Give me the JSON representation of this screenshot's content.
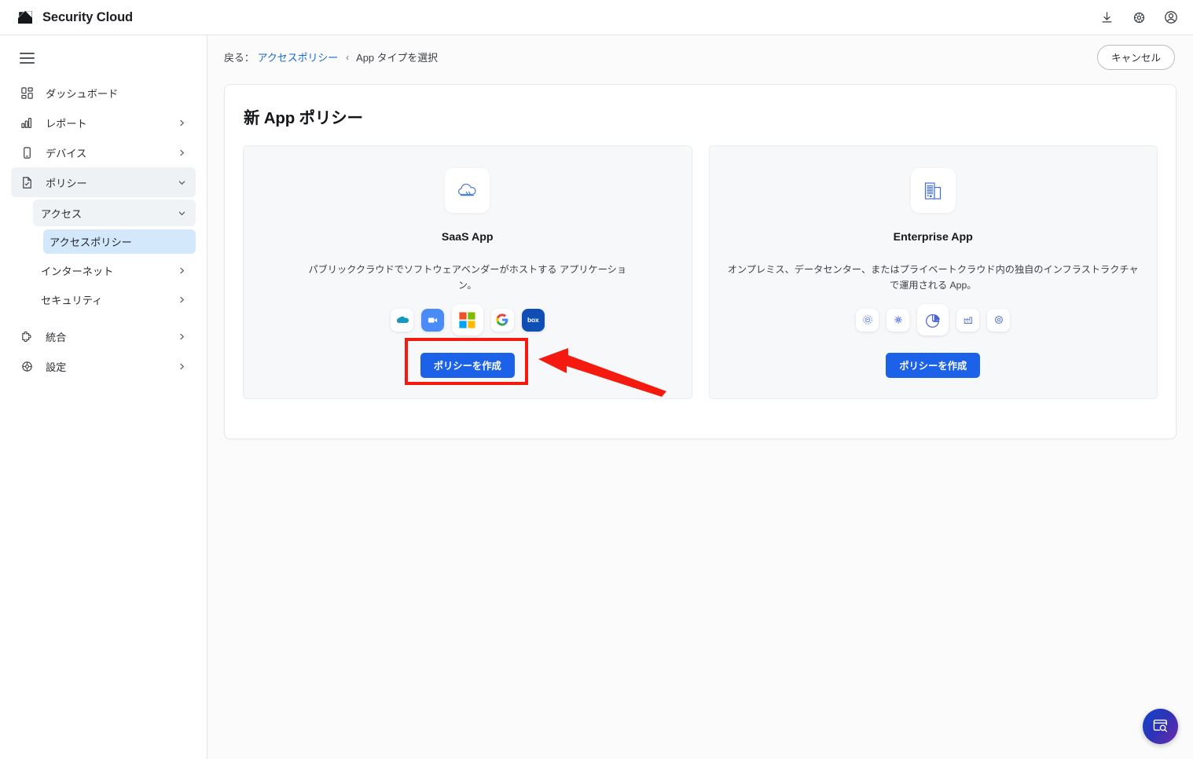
{
  "app": {
    "brand": "Security Cloud",
    "logo_icon": "security-cloud-logo"
  },
  "topbar": {
    "icons": [
      {
        "name": "download-icon",
        "label": "ダウンロード"
      },
      {
        "name": "gear-icon",
        "label": "設定"
      },
      {
        "name": "account-icon",
        "label": "アカウント"
      }
    ]
  },
  "sidebar": {
    "menu_toggle": "hamburger-icon",
    "items": [
      {
        "label": "ダッシュボード",
        "icon": "dashboard-grid-icon",
        "chevron": "",
        "state": ""
      },
      {
        "label": "レポート",
        "icon": "bar-chart-icon",
        "chevron": "›",
        "state": ""
      },
      {
        "label": "デバイス",
        "icon": "device-phone-icon",
        "chevron": "›",
        "state": ""
      },
      {
        "label": "ポリシー",
        "icon": "document-check-icon",
        "chevron": "⌄",
        "state": "active"
      }
    ],
    "sub_items": [
      {
        "label": "アクセス",
        "chevron": "⌄",
        "state": "shaded"
      }
    ],
    "sub_sub_items": [
      {
        "label": "アクセスポリシー",
        "state": "selected"
      }
    ],
    "sub_items_2": [
      {
        "label": "インターネット",
        "chevron": "›",
        "state": ""
      },
      {
        "label": "セキュリティ",
        "chevron": "›",
        "state": ""
      }
    ],
    "items_bottom": [
      {
        "label": "統合",
        "icon": "puzzle-piece-icon",
        "chevron": "›",
        "state": ""
      },
      {
        "label": "設定",
        "icon": "settings-gear-icon",
        "chevron": "›",
        "state": ""
      }
    ]
  },
  "breadcrumb": {
    "back_label": "戻る：",
    "link": "アクセスポリシー",
    "separator": "‹",
    "current": "App タイプを選択"
  },
  "header": {
    "cancel_label": "キャンセル"
  },
  "main": {
    "title": "新 App ポリシー",
    "cards": [
      {
        "id": "saas-app",
        "icon": "cloud-icon",
        "title": "SaaS App",
        "description": "パブリッククラウドでソフトウェアベンダーがホストする アプリケーション。",
        "button_label": "ポリシーを作成",
        "logos": [
          {
            "name": "salesforce-logo",
            "glyph": ""
          },
          {
            "name": "zoom-logo",
            "glyph": ""
          },
          {
            "name": "microsoft-logo",
            "glyph": ""
          },
          {
            "name": "google-logo",
            "glyph": "G"
          },
          {
            "name": "box-logo",
            "glyph": "box"
          }
        ]
      },
      {
        "id": "enterprise-app",
        "icon": "office-building-icon",
        "title": "Enterprise App",
        "description": "オンプレミス、データセンター、またはプライベートクラウド内の独自のインフラストラクチャで運用される App。",
        "button_label": "ポリシーを作成",
        "logos": [
          {
            "name": "badge-icon",
            "glyph": ""
          },
          {
            "name": "network-hub-icon",
            "glyph": ""
          },
          {
            "name": "pie-chart-icon",
            "glyph": ""
          },
          {
            "name": "factory-icon",
            "glyph": ""
          },
          {
            "name": "gear-icon",
            "glyph": ""
          }
        ]
      }
    ]
  },
  "annotation": {
    "highlight_color": "#f51a10",
    "arrow_color": "#f51a10",
    "target": "saas-app-create-policy-button"
  },
  "fab": {
    "icon": "window-search-icon",
    "gradient_from": "#1545c9",
    "gradient_to": "#6d2aa8"
  },
  "colors": {
    "accent_blue": "#1b62e8",
    "link_blue": "#1668cf",
    "selected_nav": "#d3e8fa",
    "card_bg": "#f7f8f9"
  }
}
